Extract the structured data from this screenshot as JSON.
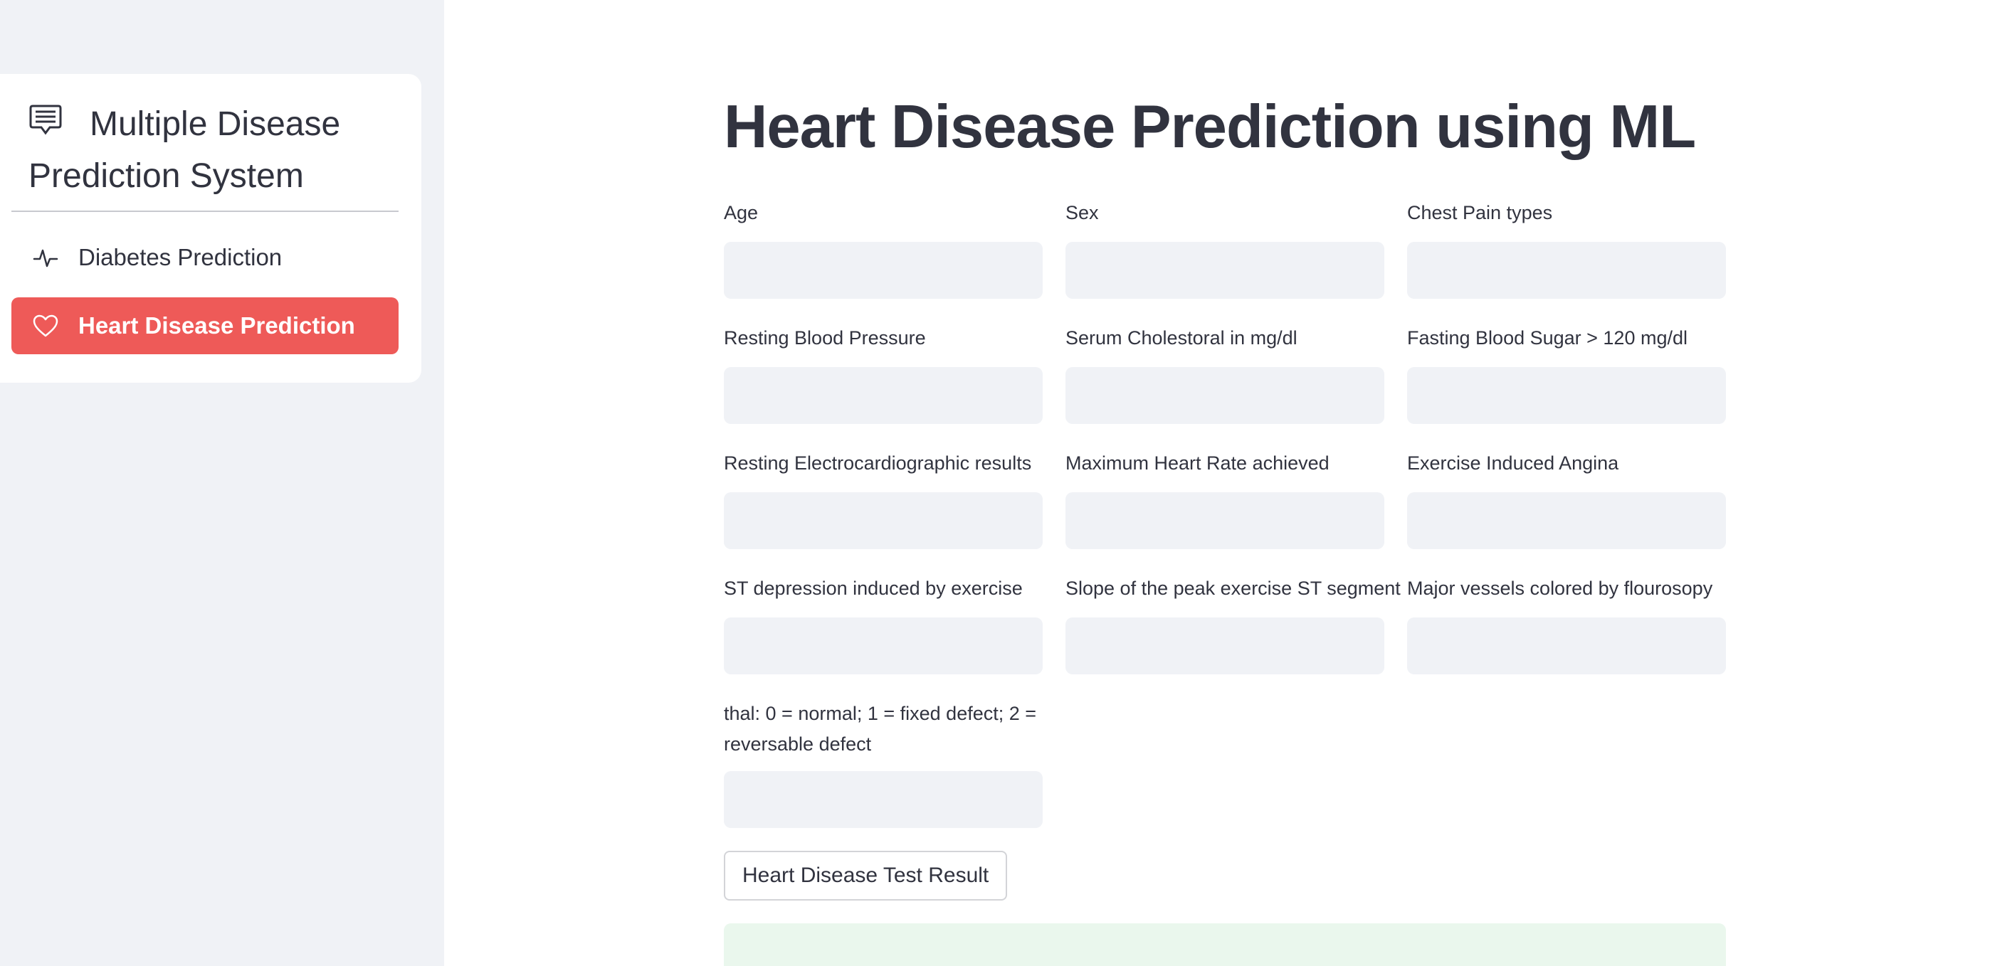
{
  "sidebar": {
    "menu_title": "Multiple Disease Prediction System",
    "menu_title_icon": "clipboard-list-icon",
    "items": [
      {
        "label": "Diabetes Prediction",
        "icon": "activity-icon",
        "selected": false
      },
      {
        "label": "Heart Disease Prediction",
        "icon": "heart-icon",
        "selected": true
      }
    ],
    "accent_color": "#ee5a58"
  },
  "main": {
    "title": "Heart Disease Prediction using ML",
    "fields": [
      {
        "label": "Age",
        "value": ""
      },
      {
        "label": "Sex",
        "value": ""
      },
      {
        "label": "Chest Pain types",
        "value": ""
      },
      {
        "label": "Resting Blood Pressure",
        "value": ""
      },
      {
        "label": "Serum Cholestoral in mg/dl",
        "value": ""
      },
      {
        "label": "Fasting Blood Sugar > 120 mg/dl",
        "value": ""
      },
      {
        "label": "Resting Electrocardiographic results",
        "value": ""
      },
      {
        "label": "Maximum Heart Rate achieved",
        "value": ""
      },
      {
        "label": "Exercise Induced Angina",
        "value": ""
      },
      {
        "label": "ST depression induced by exercise",
        "value": ""
      },
      {
        "label": "Slope of the peak exercise ST segment",
        "value": ""
      },
      {
        "label": "Major vessels colored by flourosopy",
        "value": ""
      },
      {
        "label": "thal: 0 = normal; 1 = fixed defect; 2 = reversable defect",
        "value": ""
      }
    ],
    "submit_label": "Heart Disease Test Result",
    "result_text": ""
  }
}
